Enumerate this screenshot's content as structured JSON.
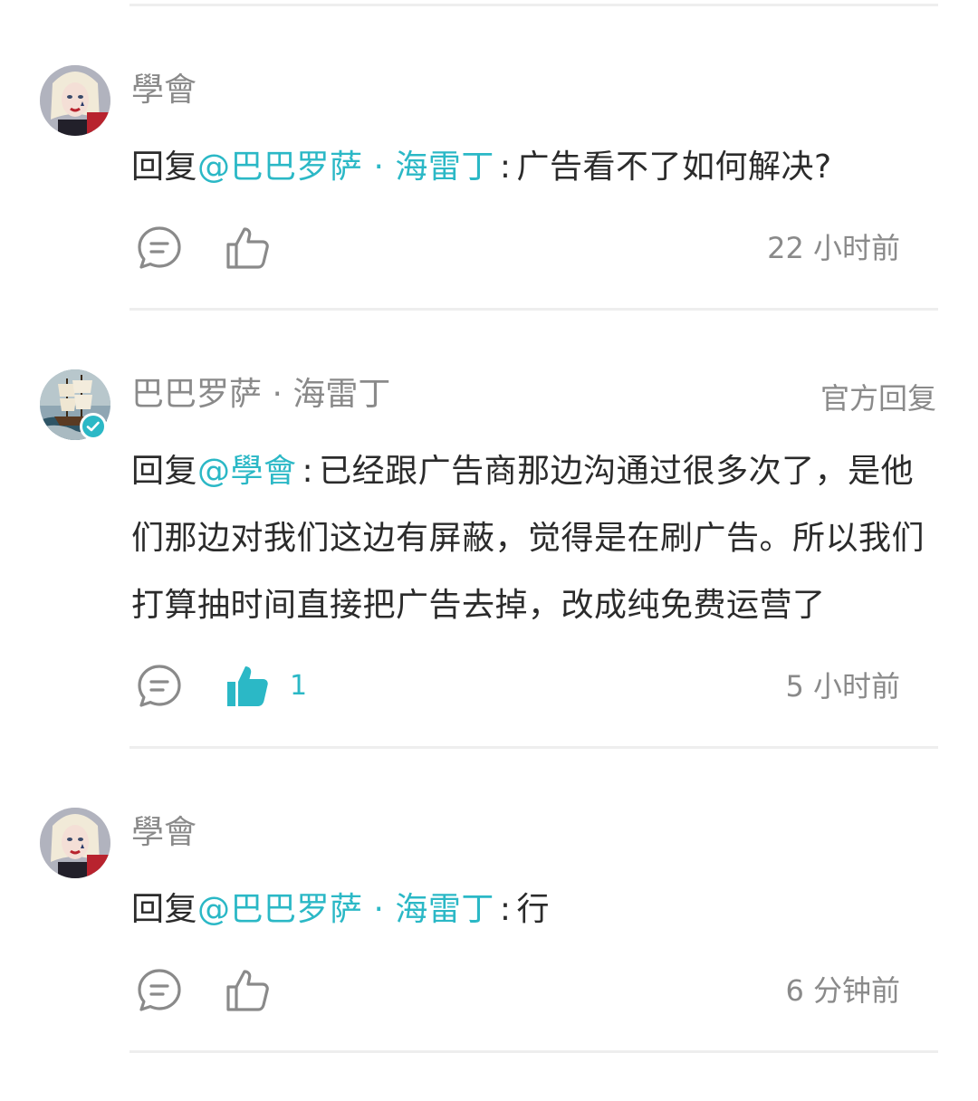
{
  "colors": {
    "accent": "#2bb8c6",
    "text": "#2b2b2b",
    "muted": "#8a8a8a",
    "divider": "#eeeeee"
  },
  "comments": [
    {
      "username": "學會",
      "avatar": "woman-avatar",
      "reply_prefix": "回复",
      "mention": "@巴巴罗萨 · 海雷丁",
      "separator": ":",
      "text": "广告看不了如何解决?",
      "like_icon": "thumbs-up-outline-icon",
      "like_count": "",
      "time": "22 小时前"
    },
    {
      "username": "巴巴罗萨 · 海雷丁",
      "avatar": "ship-avatar",
      "badge": "官方回复",
      "reply_prefix": "回复",
      "mention": "@學會",
      "separator": ":",
      "text": "已经跟广告商那边沟通过很多次了，是他们那边对我们这边有屏蔽，觉得是在刷广告。所以我们打算抽时间直接把广告去掉，改成纯免费运营了",
      "like_icon": "thumbs-up-filled-icon",
      "like_count": "1",
      "time": "5 小时前"
    },
    {
      "username": "學會",
      "avatar": "woman-avatar",
      "reply_prefix": "回复",
      "mention": "@巴巴罗萨 · 海雷丁",
      "separator": ":",
      "text": "行",
      "like_icon": "thumbs-up-outline-icon",
      "like_count": "",
      "time": "6 分钟前"
    }
  ]
}
